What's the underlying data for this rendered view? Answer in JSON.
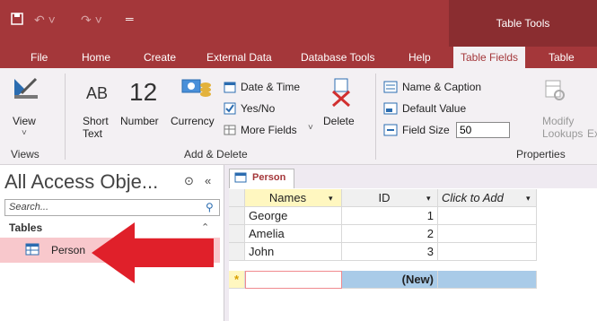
{
  "title_bar": {
    "contextual_label": "Table Tools"
  },
  "tabs": [
    "File",
    "Home",
    "Create",
    "External Data",
    "Database Tools",
    "Help",
    "Table Fields",
    "Table"
  ],
  "active_tab": "Table Fields",
  "ribbon": {
    "views": {
      "view_label": "View",
      "group_label": "Views"
    },
    "add_delete": {
      "short_text_glyph": "AB",
      "number_glyph": "12",
      "short_text_label": "Short Text",
      "number_label": "Number",
      "currency_label": "Currency",
      "date_time_label": "Date & Time",
      "yes_no_label": "Yes/No",
      "more_fields_label": "More Fields",
      "delete_label": "Delete",
      "group_label": "Add & Delete"
    },
    "properties": {
      "name_caption_label": "Name & Caption",
      "default_value_label": "Default Value",
      "field_size_label": "Field Size",
      "field_size_value": "50",
      "modify_lookups_label": "Modify Lookups",
      "expression_label": "Ex",
      "group_label": "Properties"
    }
  },
  "nav_pane": {
    "title": "All Access Obje...",
    "search_placeholder": "Search...",
    "section_label": "Tables",
    "items": [
      {
        "label": "Person"
      }
    ]
  },
  "datasheet": {
    "tab_label": "Person",
    "columns": [
      "Names",
      "ID",
      "Click to Add"
    ],
    "rows": [
      {
        "names": "George",
        "id": "1"
      },
      {
        "names": "Amelia",
        "id": "2"
      },
      {
        "names": "John",
        "id": "3"
      }
    ],
    "new_row_marker": "*",
    "new_row_id": "(New)"
  },
  "colors": {
    "accent": "#a4373a",
    "arrow": "#e0202a",
    "selected_item": "#f8c8cc"
  }
}
